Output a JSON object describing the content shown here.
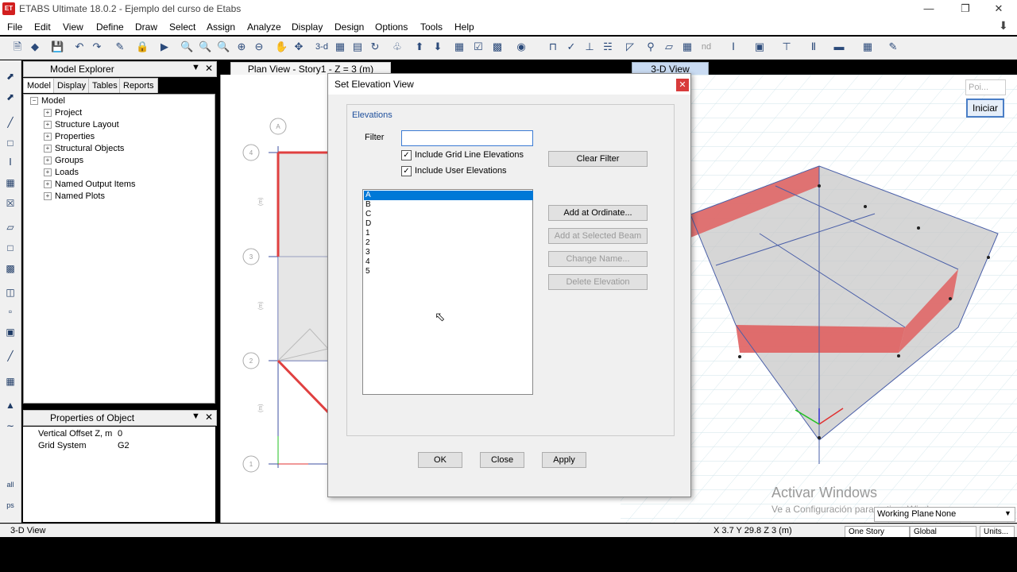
{
  "window": {
    "title": "ETABS Ultimate 18.0.2 - Ejemplo del curso de Etabs",
    "app_icon_text": "ET"
  },
  "menus": [
    "File",
    "Edit",
    "View",
    "Define",
    "Draw",
    "Select",
    "Assign",
    "Analyze",
    "Display",
    "Design",
    "Options",
    "Tools",
    "Help"
  ],
  "toolbar": {
    "tb_3d_label": "3-d",
    "tb_nd_label": "nd"
  },
  "model_explorer": {
    "title": "Model Explorer",
    "tabs": [
      "Model",
      "Display",
      "Tables",
      "Reports"
    ],
    "tree_root": "Model",
    "tree_items": [
      "Project",
      "Structure Layout",
      "Properties",
      "Structural Objects",
      "Groups",
      "Loads",
      "Named Output Items",
      "Named Plots"
    ]
  },
  "properties_panel": {
    "title": "Properties of Object",
    "rows": [
      {
        "key": "Vertical Offset Z, m",
        "value": "0"
      },
      {
        "key": "Grid System",
        "value": "G2"
      }
    ]
  },
  "plan_view": {
    "tab_title": "Plan View - Story1 - Z = 3 (m)",
    "grid_bubbles": [
      "A",
      "4",
      "3",
      "2",
      "1"
    ],
    "dim_label": "(m)"
  },
  "view_3d": {
    "tab_title": "3-D View",
    "point_label": "Poi...",
    "iniciar_label": "Iniciar"
  },
  "dialog": {
    "title": "Set Elevation View",
    "group_label": "Elevations",
    "filter_label": "Filter",
    "filter_value": "",
    "include_grid_label": "Include Grid Line Elevations",
    "include_user_label": "Include User Elevations",
    "include_grid_checked": true,
    "include_user_checked": true,
    "list_items": [
      "A",
      "B",
      "C",
      "D",
      "1",
      "2",
      "3",
      "4",
      "5"
    ],
    "selected_item": "A",
    "clear_filter": "Clear Filter",
    "add_at_ordinate": "Add at Ordinate...",
    "add_at_selected_beam": "Add at Selected Beam",
    "change_name": "Change Name...",
    "delete_elevation": "Delete Elevation",
    "ok": "OK",
    "close": "Close",
    "apply": "Apply"
  },
  "watermark": {
    "line1": "Activar Windows",
    "line2": "Ve a Configuración para activar Windows."
  },
  "working_plane": {
    "label": "Working Plane",
    "value": "None"
  },
  "status": {
    "left": "3-D View",
    "coords": "X 3.7  Y 29.8  Z 3 (m)",
    "story_select": "One Story",
    "coord_system": "Global",
    "units": "Units..."
  },
  "colors": {
    "selection": "#0078d7",
    "accent": "#1e4f9c",
    "wall": "#e06060",
    "grid_line": "#4a5fa8"
  }
}
